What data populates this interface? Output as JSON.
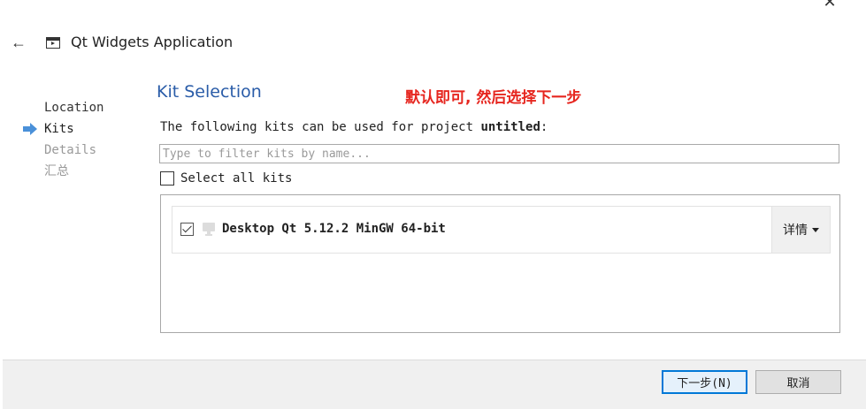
{
  "window": {
    "title": "Qt Widgets Application",
    "close_symbol": "✕"
  },
  "steps": [
    {
      "label": "Location",
      "state": "done"
    },
    {
      "label": "Kits",
      "state": "current"
    },
    {
      "label": "Details",
      "state": "pending"
    },
    {
      "label": "汇总",
      "state": "pending"
    }
  ],
  "main": {
    "section_title": "Kit Selection",
    "annotation": "默认即可, 然后选择下一步",
    "description_prefix": "The following kits can be used for project ",
    "project_name": "untitled",
    "description_suffix": ":",
    "filter": {
      "placeholder": "Type to filter kits by name...",
      "value": ""
    },
    "select_all": {
      "label": "Select all kits",
      "checked": false
    },
    "kits": [
      {
        "name": "Desktop Qt 5.12.2 MinGW 64-bit",
        "checked": true,
        "details_label": "详情"
      }
    ]
  },
  "footer": {
    "next_label": "下一步(N)",
    "cancel_label": "取消"
  },
  "colors": {
    "accent": "#2a5ca8",
    "annotation": "#e6261f",
    "step_arrow": "#4a90d9",
    "default_button_border": "#0078d7"
  }
}
